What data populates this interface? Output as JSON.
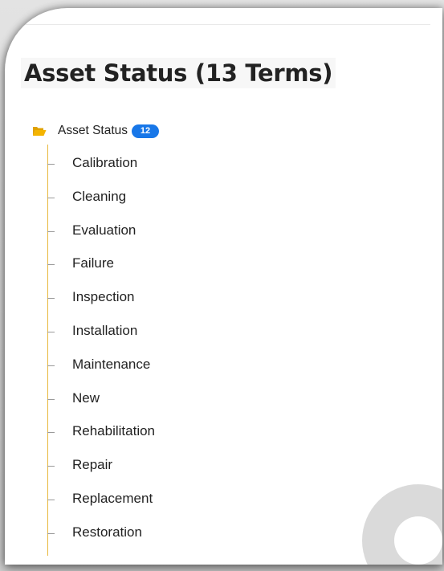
{
  "page": {
    "title": "Asset Status (13 Terms)"
  },
  "tree": {
    "root": {
      "icon": "folder-open-icon",
      "label": "Asset Status",
      "badge": "12"
    },
    "items": [
      {
        "label": "Calibration"
      },
      {
        "label": "Cleaning"
      },
      {
        "label": "Evaluation"
      },
      {
        "label": "Failure"
      },
      {
        "label": "Inspection"
      },
      {
        "label": "Installation"
      },
      {
        "label": "Maintenance"
      },
      {
        "label": "New"
      },
      {
        "label": "Rehabilitation"
      },
      {
        "label": "Repair"
      },
      {
        "label": "Replacement"
      },
      {
        "label": "Restoration"
      }
    ]
  },
  "colors": {
    "badge": "#1877e8",
    "folder": "#f4b400",
    "tree_line": "#e8b83c"
  }
}
